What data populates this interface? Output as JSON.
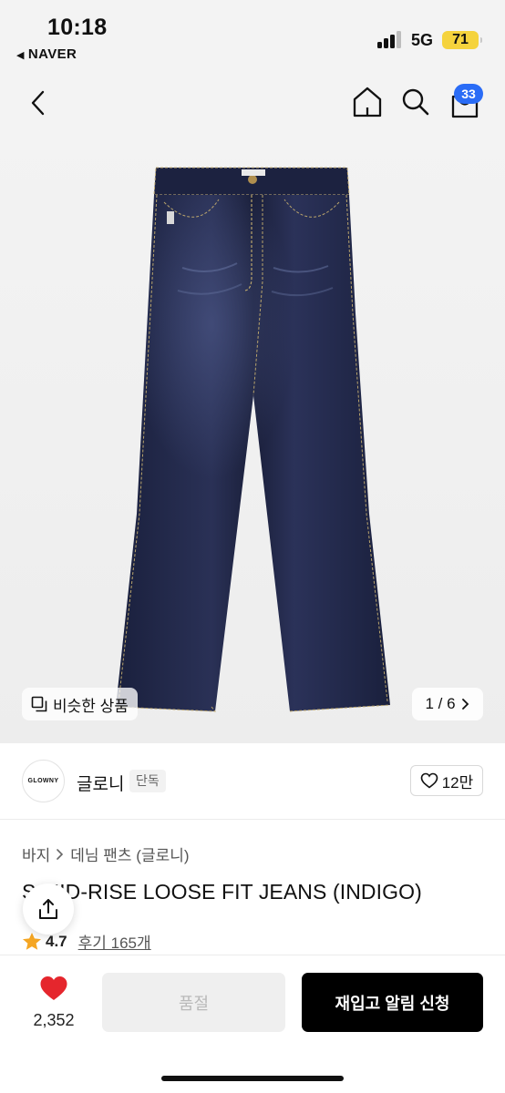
{
  "status_bar": {
    "time": "10:18",
    "back_app": "NAVER",
    "network": "5G",
    "battery": "71"
  },
  "nav": {
    "cart_count": "33",
    "icons": [
      "back-icon",
      "home-icon",
      "search-icon",
      "cart-icon"
    ]
  },
  "hero": {
    "similar_label": "비슷한 상품",
    "pager": "1 / 6"
  },
  "brand": {
    "logo_text": "GLOWNY",
    "name": "글로니",
    "tag": "단독",
    "likes": "12만"
  },
  "product": {
    "breadcrumb": [
      "바지",
      "데님 팬츠 (글로니)"
    ],
    "title": "S MID-RISE LOOSE FIT JEANS (INDIGO)",
    "rating": "4.7",
    "reviews": "후기 165개"
  },
  "bottom": {
    "heart_count": "2,352",
    "soldout_label": "품절",
    "restock_label": "재입고 알림 신청"
  },
  "colors": {
    "accent_blue": "#2a6cf6",
    "heart_red": "#e5262d",
    "battery_yellow": "#f5d33d",
    "denim": "#1d2340"
  }
}
